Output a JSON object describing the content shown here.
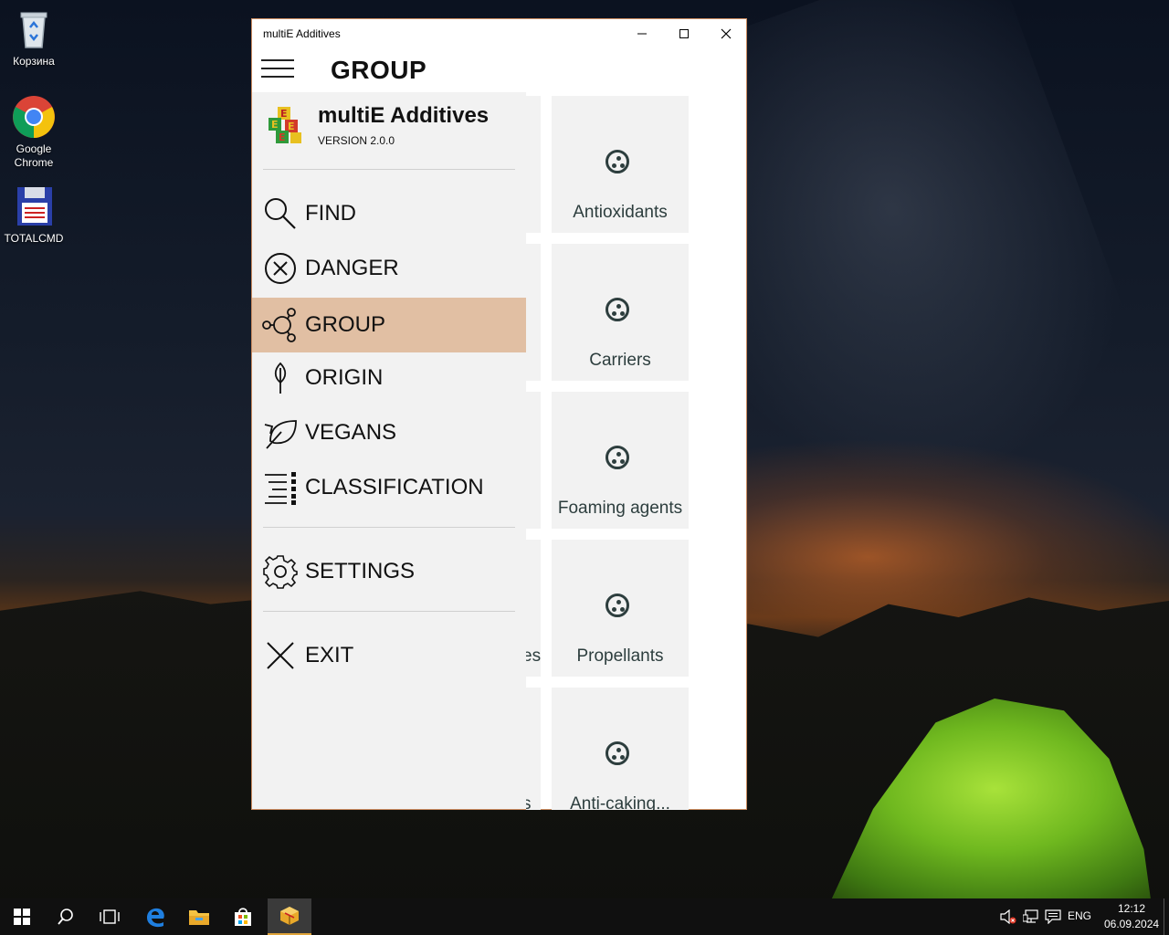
{
  "desktop": {
    "icons": [
      {
        "label": "Корзина"
      },
      {
        "label": "Google Chrome"
      },
      {
        "label": "TOTALCMD"
      }
    ]
  },
  "window": {
    "title": "multiE Additives",
    "controls": {
      "minimize": "minimize-icon",
      "maximize": "maximize-icon",
      "close": "close-icon"
    }
  },
  "header": {
    "page_title": "GROUP"
  },
  "nav": {
    "app_name": "multiE Additives",
    "version": "VERSION 2.0.0",
    "items": [
      {
        "label": "FIND",
        "icon": "search-icon"
      },
      {
        "label": "DANGER",
        "icon": "circle-x-icon"
      },
      {
        "label": "GROUP",
        "icon": "group-icon",
        "selected": true
      },
      {
        "label": "ORIGIN",
        "icon": "origin-icon"
      },
      {
        "label": "VEGANS",
        "icon": "leaf-icon"
      },
      {
        "label": "CLASSIFICATION",
        "icon": "classification-icon"
      }
    ],
    "settings_label": "SETTINGS",
    "exit_label": "EXIT"
  },
  "tiles": [
    {
      "label": "Antioxidants"
    },
    {
      "label": "Carriers"
    },
    {
      "label": "Foaming agents"
    },
    {
      "label": "Propellants"
    },
    {
      "label": "Anti-caking..."
    }
  ],
  "left_tile_fragments": [
    "",
    "",
    "",
    "es",
    "s"
  ],
  "taskbar": {
    "language": "ENG",
    "time": "12:12",
    "date": "06.09.2024"
  },
  "colors": {
    "selected_nav": "#e1bfa3",
    "window_border": "#c98a5f",
    "tile_bg": "#f2f2f2",
    "tile_text": "#2d3e3e"
  }
}
